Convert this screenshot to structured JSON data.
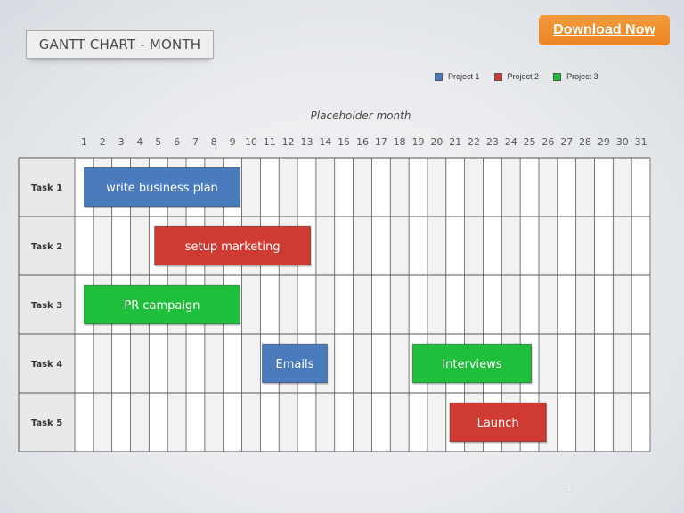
{
  "title_box": {
    "text": "GANTT CHART - MONTH"
  },
  "download_button": {
    "label": "Download Now"
  },
  "page_number": "1",
  "colors": {
    "project1": "#4a7bbd",
    "project2": "#cf3b32",
    "project3": "#1fbe3b",
    "download": "#ee8a28"
  },
  "chart_data": {
    "type": "gantt",
    "title": "GANTT CHART - MONTH",
    "subtitle": "Placeholder month",
    "xlabel": "Placeholder month",
    "days": [
      "1",
      "2",
      "3",
      "4",
      "5",
      "6",
      "7",
      "8",
      "9",
      "10",
      "11",
      "12",
      "13",
      "14",
      "15",
      "16",
      "17",
      "18",
      "19",
      "20",
      "21",
      "22",
      "23",
      "24",
      "25",
      "26",
      "27",
      "28",
      "29",
      "30",
      "31"
    ],
    "xlim": [
      1,
      31
    ],
    "legend": [
      {
        "name": "Project 1",
        "color": "#4a7bbd"
      },
      {
        "name": "Project 2",
        "color": "#cf3b32"
      },
      {
        "name": "Project 3",
        "color": "#1fbe3b"
      }
    ],
    "legend_position": "top-right",
    "tasks": [
      "Task 1",
      "Task 2",
      "Task 3",
      "Task 4",
      "Task 5"
    ],
    "bars": [
      {
        "task": "Task 1",
        "label": "write business plan",
        "project": "Project 1",
        "start": 1.5,
        "end": 9.9
      },
      {
        "task": "Task 2",
        "label": "setup marketing",
        "project": "Project 2",
        "start": 5.3,
        "end": 13.7
      },
      {
        "task": "Task 3",
        "label": "PR campaign",
        "project": "Project 3",
        "start": 1.5,
        "end": 9.9
      },
      {
        "task": "Task 4",
        "label": "Emails",
        "project": "Project 1",
        "start": 11.1,
        "end": 14.6
      },
      {
        "task": "Task 4",
        "label": "Interviews",
        "project": "Project 3",
        "start": 19.2,
        "end": 25.6
      },
      {
        "task": "Task 5",
        "label": "Launch",
        "project": "Project 2",
        "start": 21.2,
        "end": 26.4
      }
    ]
  }
}
